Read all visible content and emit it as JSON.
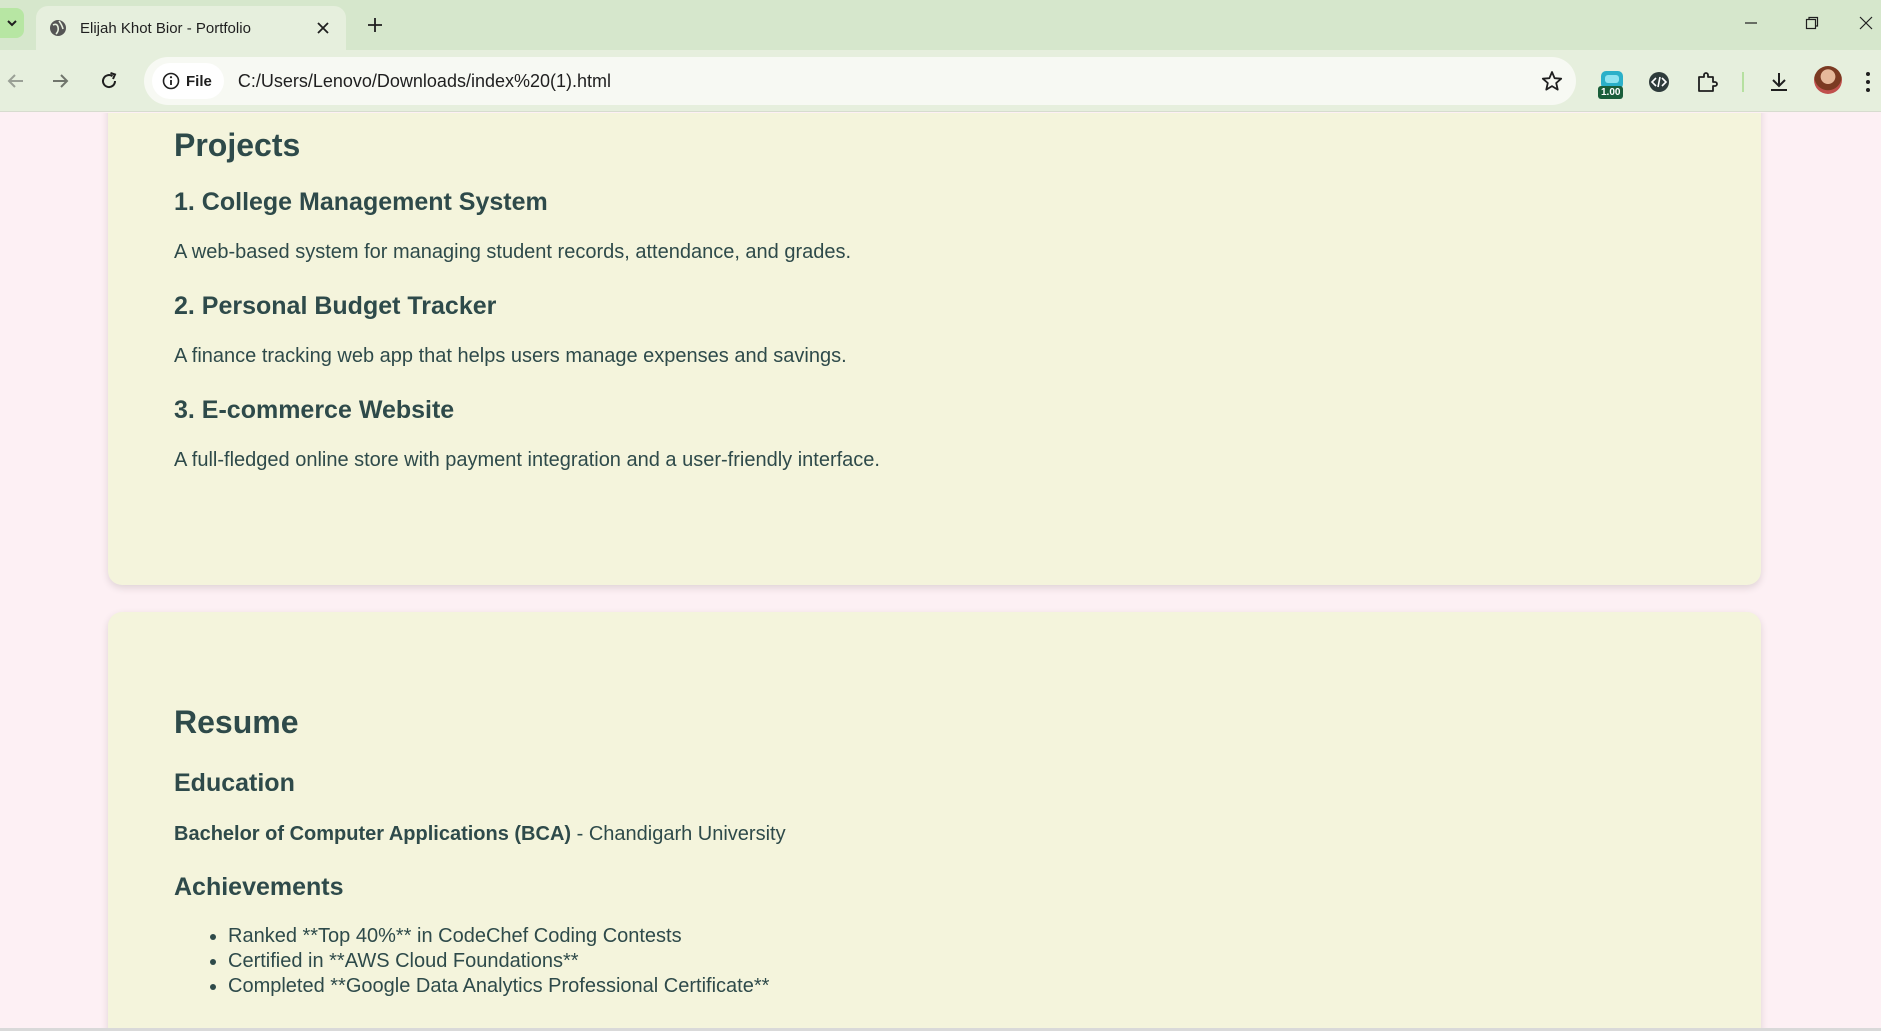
{
  "browser": {
    "tab_title": "Elijah Khot Bior - Portfolio",
    "url_chip_label": "File",
    "url": "C:/Users/Lenovo/Downloads/index%20(1).html",
    "extension_badge": "1.00"
  },
  "projects": {
    "heading": "Projects",
    "items": [
      {
        "title": "1. College Management System",
        "description": "A web-based system for managing student records, attendance, and grades."
      },
      {
        "title": "2. Personal Budget Tracker",
        "description": "A finance tracking web app that helps users manage expenses and savings."
      },
      {
        "title": "3. E-commerce Website",
        "description": "A full-fledged online store with payment integration and a user-friendly interface."
      }
    ]
  },
  "resume": {
    "heading": "Resume",
    "education_heading": "Education",
    "degree": "Bachelor of Computer Applications (BCA)",
    "institution": " - Chandigarh University",
    "achievements_heading": "Achievements",
    "achievements": [
      "Ranked **Top 40%** in CodeChef Coding Contests",
      "Certified in **AWS Cloud Foundations**",
      "Completed **Google Data Analytics Professional Certificate**"
    ]
  }
}
